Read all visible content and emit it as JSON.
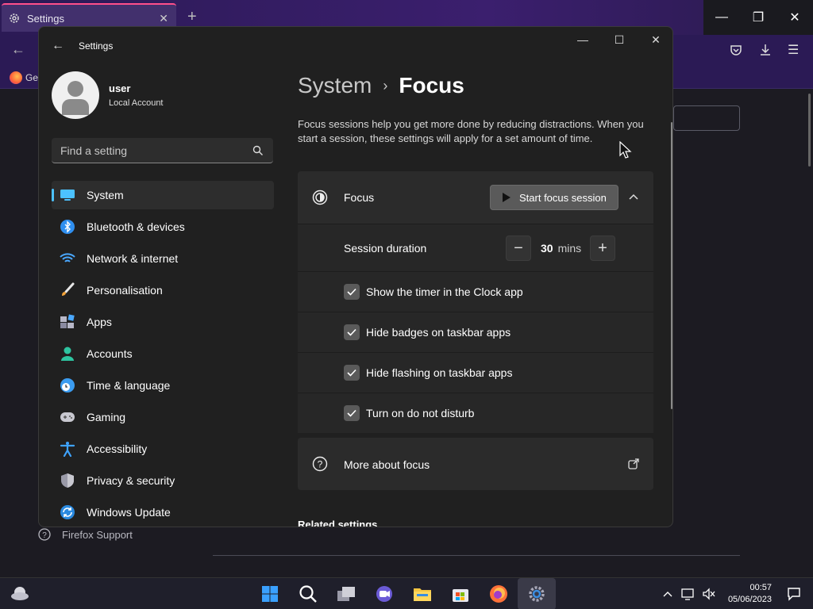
{
  "firefox": {
    "tab_title": "Settings",
    "bookmark_text": "Get",
    "support_link": "Firefox Support"
  },
  "settings": {
    "window_title": "Settings",
    "profile": {
      "name": "user",
      "account_type": "Local Account"
    },
    "search": {
      "placeholder": "Find a setting"
    },
    "nav": [
      {
        "label": "System",
        "icon": "monitor-icon",
        "active": true
      },
      {
        "label": "Bluetooth & devices",
        "icon": "bluetooth-icon"
      },
      {
        "label": "Network & internet",
        "icon": "wifi-icon"
      },
      {
        "label": "Personalisation",
        "icon": "brush-icon"
      },
      {
        "label": "Apps",
        "icon": "apps-icon"
      },
      {
        "label": "Accounts",
        "icon": "person-icon"
      },
      {
        "label": "Time & language",
        "icon": "globe-clock-icon"
      },
      {
        "label": "Gaming",
        "icon": "gamepad-icon"
      },
      {
        "label": "Accessibility",
        "icon": "accessibility-icon"
      },
      {
        "label": "Privacy & security",
        "icon": "shield-icon"
      },
      {
        "label": "Windows Update",
        "icon": "update-icon"
      }
    ],
    "breadcrumb": {
      "parent": "System",
      "current": "Focus"
    },
    "description": "Focus sessions help you get more done by reducing distractions. When you start a session, these settings will apply for a set amount of time.",
    "focus": {
      "label": "Focus",
      "start_button": "Start focus session",
      "duration_label": "Session duration",
      "duration_value": "30",
      "duration_unit": "mins",
      "options": [
        {
          "label": "Show the timer in the Clock app",
          "checked": true
        },
        {
          "label": "Hide badges on taskbar apps",
          "checked": true
        },
        {
          "label": "Hide flashing on taskbar apps",
          "checked": true
        },
        {
          "label": "Turn on do not disturb",
          "checked": true
        }
      ]
    },
    "more_about": "More about focus",
    "related_heading": "Related settings"
  },
  "taskbar": {
    "time": "00:57",
    "date": "05/06/2023"
  },
  "colors": {
    "accent": "#4cc2ff",
    "window_bg": "#202020",
    "card_bg": "#2b2b2b"
  }
}
